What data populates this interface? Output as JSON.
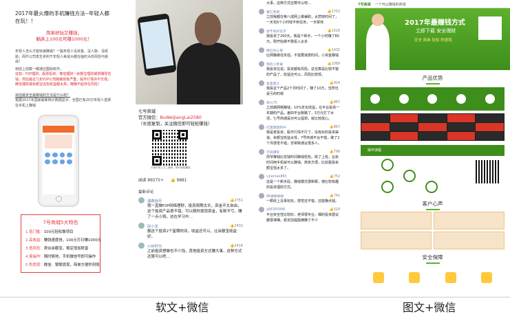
{
  "page1": {
    "title": "2017年最火爆的手机赚钱方法--年轻人都在玩！！",
    "sub1": "简单好玩又赚钱，",
    "sub2": "躺床上100元可赚1000元！",
    "para1": "年轻人怎么才能快速赚钱？一般年轻人没资金、没人脉、没经验，而升公司发生资利于年轻人来说大都在临时大的风险与挑战！",
    "para2": "到前上前数一眼通过图标软件，",
    "para3": "这如：P2P理财、股票投资、微信理财一余额宝理财或拼赚零花钱，然后最近几年P2P公司跑路现象严重，股市行情并不乐观，微信理财或余额宝这些收益都太高，赚赚不起存在风险！",
    "link": "目前最安全最赚钱的方法是什么呢？",
    "para4": "根据2017年国家最新统计数据显示：全国已有20万年轻人选择在手机上赚钱",
    "box_title": "7号商城5大特色",
    "features": [
      {
        "k": "1.低门槛：",
        "v": "100元轻松做项目"
      },
      {
        "k": "2.高收益：",
        "v": "赚钱速度快，100元可日赚1000元"
      },
      {
        "k": "3.低风险：",
        "v": "类似余额宝，稳定增加财富"
      },
      {
        "k": "4.易操作：",
        "v": "随时随地，手机微信号即可操作"
      },
      {
        "k": "5.秒提现：",
        "v": "微信、银联提现，简单方便秒到账"
      }
    ]
  },
  "page2": {
    "shop": "七号商城",
    "wechat_label": "官方微信：",
    "wechat_id": "BuWeiJiangLai2580",
    "wechat_note": "（长按复制，关注微信即可轻松赚钱）",
    "qr_caption": "长按识别上方二维码，即可轻松赚钱",
    "reads": "阅读 86575+",
    "likes": "9881",
    "section": "最新评论",
    "comments": [
      {
        "name": "遇鑫逍月",
        "likes": "2751",
        "text": "我一直做P2P网络理财，投资周期太长，资金不太自由，这个投资产品很不错，可以随时提现资金，有账不亏，赚了一点小钱，这在学习中…"
      },
      {
        "name": "段小龙",
        "likes": "2432",
        "text": "额这个投资2个星期时间，收益还可以，比余额宝收益好。"
      },
      {
        "name": "小树时代",
        "likes": "2416",
        "text": "之前投资想做也不少钱，其他投资方式赚大事，这种方式还算可以吧…"
      }
    ]
  },
  "page3": {
    "comments": [
      {
        "name": "",
        "likes": "",
        "text": "大事，这种方式还算可以吧…"
      },
      {
        "name": "蒙忆亲德",
        "likes": "1753",
        "text": "之前我都在等八成网上做兼职，太悲惨时间了，一天花6个小时收不到任务，一天累死"
      },
      {
        "name": "想不到好名字",
        "likes": "1529",
        "text": "我投资了200元，我是个新手，一个小时赚了80元，刚开始做不敢投入太多"
      },
      {
        "name": "微信你心事",
        "likes": "1432",
        "text": "比网赚做任务强，不需要浪费时间，小资金赚钱"
      },
      {
        "name": "我的小苹果",
        "likes": "1089",
        "text": "我投资在说，投资都有风险，这也算是比较不错的产品了，收益还可以，风险比较低。"
      },
      {
        "name": "柔量美兰",
        "likes": "924",
        "text": "我投这个产品2个月时间了，赚了10万，当然也是亏的时候"
      },
      {
        "name": "高兴75",
        "likes": "887",
        "text": "之前做网络赚钱，10%年化收益，在平台投资一年期的产品，差四平台跑路了，5万元打了水漂，七号商城是对可以提现，就比较放心。"
      },
      {
        "name": "红旗飘飘804",
        "likes": "867",
        "text": "我是老投资，股市行情不行了，没有好的投资渠道。余额宝收益太低，7号商城平台不错，做了2个月感觉不错，非常跨通议很多人。"
      },
      {
        "name": "不得拂军",
        "likes": "799",
        "text": "周爷赚钱比花钱时间赚钱轻松。除了上班，业余时间用手机就可以赚钱。简单方便，比割拔投余额宝强太多了。"
      },
      {
        "name": "v.Jiantao865",
        "likes": "752",
        "text": "这是一个新手段，赚钱模式很新颖，使比较有趣的投资理财方式。"
      },
      {
        "name": "86做路鲜鲜",
        "likes": "741",
        "text": "一颗收上没事玩玩，感觉还不错，还能赚点钱。"
      },
      {
        "name": "y84305896",
        "likes": "524",
        "text": "平台安全性比较好，老师很专业，细的投资建议都很准确，稳定前提能摘赚了不少"
      }
    ]
  },
  "page4": {
    "site": "7号商城",
    "site_sub": "一个可以赚钱的商城",
    "banner_title": "2017年最赚钱方式",
    "banner_tag": "立即下载 安全理财",
    "banner_sub": "安全 简单 轻松 秒提现",
    "sec1": "产品优势",
    "sec2": "操作流程",
    "sec3": "客户心声",
    "sec4": "安全保障"
  },
  "captions": {
    "left": "软文+微信",
    "right": "图文+微信"
  }
}
